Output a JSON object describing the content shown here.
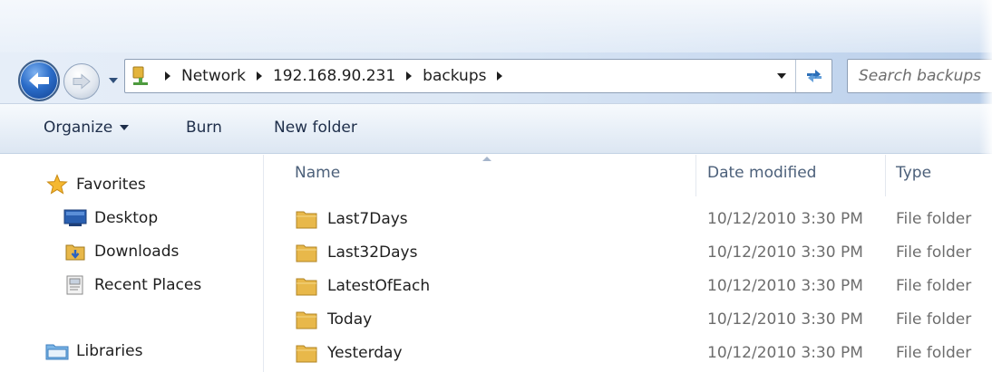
{
  "address_bar": {
    "crumbs": [
      "Network",
      "192.168.90.231",
      "backups"
    ],
    "location_icon": "network-folder-icon"
  },
  "search": {
    "placeholder": "Search backups"
  },
  "toolbar": {
    "organize_label": "Organize",
    "burn_label": "Burn",
    "new_folder_label": "New folder"
  },
  "nav_pane": {
    "favorites_label": "Favorites",
    "favorites_items": [
      {
        "label": "Desktop",
        "icon": "desktop-icon"
      },
      {
        "label": "Downloads",
        "icon": "downloads-folder-icon"
      },
      {
        "label": "Recent Places",
        "icon": "recent-places-icon"
      }
    ],
    "libraries_label": "Libraries"
  },
  "columns": {
    "name": "Name",
    "date_modified": "Date modified",
    "type": "Type"
  },
  "files": [
    {
      "name": "Last7Days",
      "date": "10/12/2010 3:30 PM",
      "type": "File folder"
    },
    {
      "name": "Last32Days",
      "date": "10/12/2010 3:30 PM",
      "type": "File folder"
    },
    {
      "name": "LatestOfEach",
      "date": "10/12/2010 3:30 PM",
      "type": "File folder"
    },
    {
      "name": "Today",
      "date": "10/12/2010 3:30 PM",
      "type": "File folder"
    },
    {
      "name": "Yesterday",
      "date": "10/12/2010 3:30 PM",
      "type": "File folder"
    }
  ],
  "colors": {
    "frame": "#dde8f5",
    "toolbar_text": "#1e2e4a",
    "secondary_text": "#6d6d6d",
    "header_text": "#4c607a",
    "folder": "#e8b84a"
  }
}
